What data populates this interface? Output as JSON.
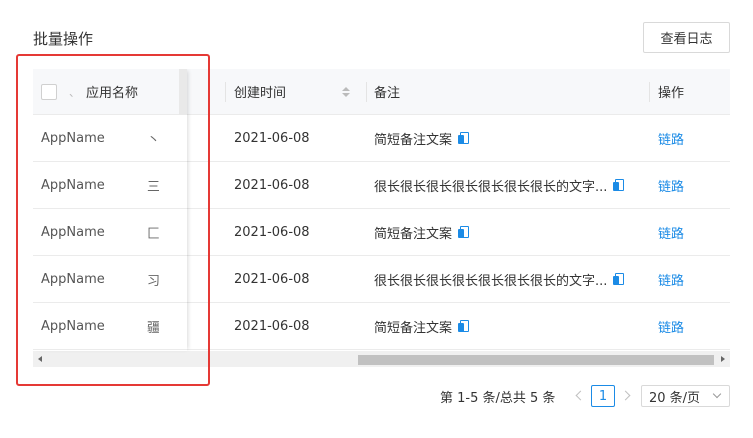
{
  "header": {
    "title": "批量操作",
    "log_button": "查看日志"
  },
  "table": {
    "columns": {
      "app_name": "应用名称",
      "created": "创建时间",
      "note": "备注",
      "action": "操作"
    },
    "rows": [
      {
        "app": "AppName",
        "frag": "丶",
        "date": "2021-06-08",
        "note": "简短备注文案",
        "action": "链路"
      },
      {
        "app": "AppName",
        "frag": "三",
        "date": "2021-06-08",
        "note": "很长很长很长很长很长很长很长的文字...",
        "action": "链路"
      },
      {
        "app": "AppName",
        "frag": "匚",
        "date": "2021-06-08",
        "note": "简短备注文案",
        "action": "链路"
      },
      {
        "app": "AppName",
        "frag": "习",
        "date": "2021-06-08",
        "note": "很长很长很长很长很长很长很长的文字...",
        "action": "链路"
      },
      {
        "app": "AppName",
        "frag": "疆",
        "date": "2021-06-08",
        "note": "简短备注文案",
        "action": "链路"
      }
    ]
  },
  "pagination": {
    "summary": "第 1-5 条/总共 5 条",
    "current_page": "1",
    "page_size": "20 条/页"
  },
  "colors": {
    "accent": "#1b8be6",
    "highlight": "#e53935",
    "header_bg": "#f7f8fa"
  }
}
